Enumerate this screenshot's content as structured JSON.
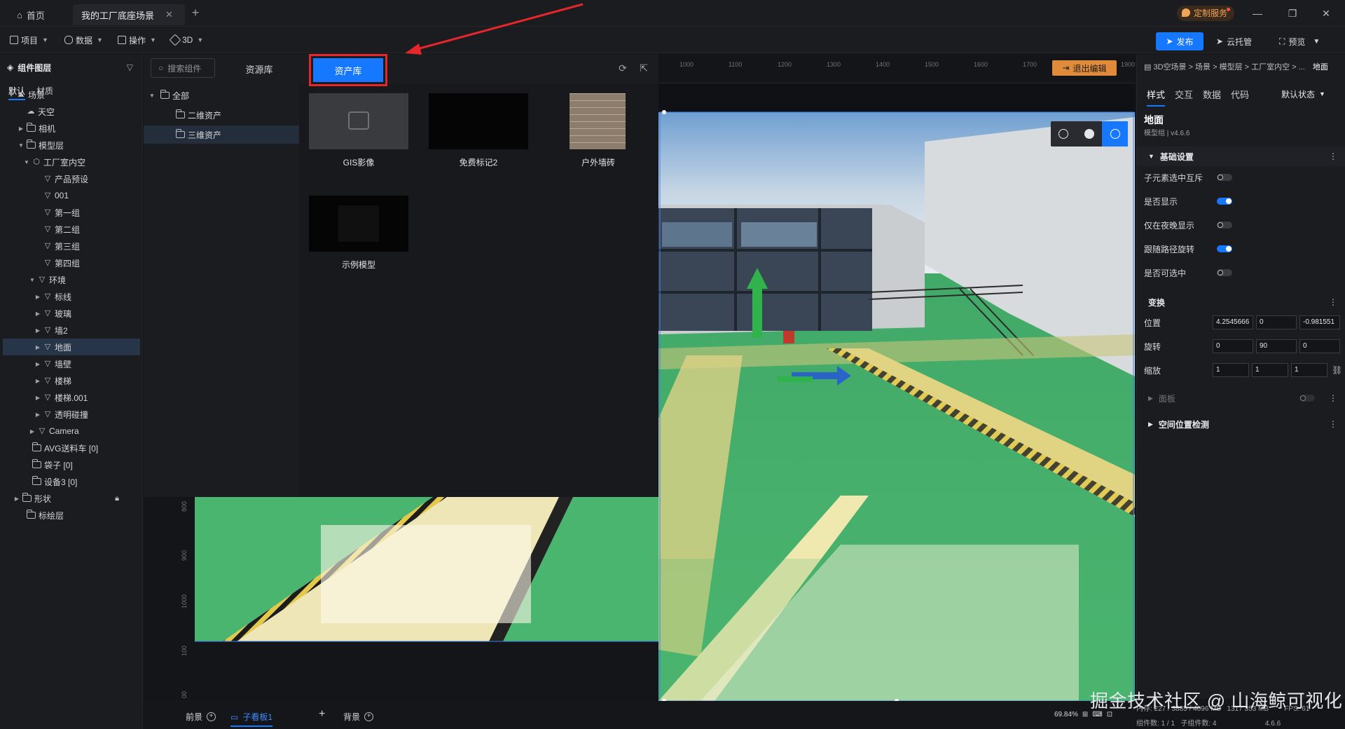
{
  "titlebar": {
    "tabs": [
      {
        "label": "首页"
      },
      {
        "label": "我的工厂底座场景"
      }
    ],
    "custom_service": "定制服务"
  },
  "toolbar": {
    "menus": [
      "项目",
      "数据",
      "操作",
      "3D"
    ],
    "publish": "发布",
    "cloud": "云托管",
    "preview": "预览"
  },
  "layer_panel": {
    "title": "组件图层",
    "tabs": [
      "默认",
      "材质"
    ],
    "items": [
      {
        "label": "场景"
      },
      {
        "label": "天空"
      },
      {
        "label": "相机"
      },
      {
        "label": "模型层"
      },
      {
        "label": "工厂室内空"
      },
      {
        "label": "产品预设"
      },
      {
        "label": "001"
      },
      {
        "label": "第一组"
      },
      {
        "label": "第二组"
      },
      {
        "label": "第三组"
      },
      {
        "label": "第四组"
      },
      {
        "label": "环境"
      },
      {
        "label": "标线"
      },
      {
        "label": "玻璃"
      },
      {
        "label": "墙2"
      },
      {
        "label": "地面"
      },
      {
        "label": "墙壁"
      },
      {
        "label": "楼梯"
      },
      {
        "label": "楼梯.001"
      },
      {
        "label": "透明碰撞"
      },
      {
        "label": "Camera"
      },
      {
        "label": "AVG送料车 [0]"
      },
      {
        "label": "袋子 [0]"
      },
      {
        "label": "设备3 [0]"
      },
      {
        "label": "形状"
      },
      {
        "label": "标绘层"
      }
    ]
  },
  "asset_panel": {
    "search_placeholder": "搜索组件",
    "resource_tab": "资源库",
    "asset_tab": "资产库",
    "tree": [
      {
        "label": "全部"
      },
      {
        "label": "二维资产"
      },
      {
        "label": "三维资产"
      }
    ],
    "assets": [
      {
        "label": "GIS影像"
      },
      {
        "label": "免费标记2"
      },
      {
        "label": "户外墙砖"
      },
      {
        "label": "示例模型"
      }
    ]
  },
  "viewport": {
    "ruler_top": [
      "1000",
      "1100",
      "1200",
      "1300",
      "1400",
      "1500",
      "1600",
      "1700",
      "1900"
    ],
    "ruler_left": [
      "800",
      "900",
      "1000",
      "100",
      "00"
    ],
    "exit_edit": "退出编辑"
  },
  "bottom_bar": {
    "foreground": "前景",
    "sub_board": "子看板1",
    "background": "背景",
    "zoom": "69.84%"
  },
  "status": {
    "line1": "内存: 227 / 3885 / 4096 MB   1317 353 MB        FPS: 61",
    "line2": "组件数: 1 / 1   子组件数: 4                         4.6.6"
  },
  "watermark": "掘金技术社区 @ 山海鲸可视化",
  "props": {
    "breadcrumb": "3D空场景 > 场景 > 模型层 > 工厂室内空 > ...",
    "breadcrumb_current": "地面",
    "tabs": [
      "样式",
      "交互",
      "数据",
      "代码"
    ],
    "state": "默认状态",
    "object_name": "地面",
    "object_sub": "模型组 | v4.6.6",
    "section_basic": "基础设置",
    "toggles": [
      {
        "label": "子元素选中互斥",
        "on": false
      },
      {
        "label": "是否显示",
        "on": true
      },
      {
        "label": "仅在夜晚显示",
        "on": false
      },
      {
        "label": "跟随路径旋转",
        "on": true
      },
      {
        "label": "是否可选中",
        "on": false
      }
    ],
    "section_transform": "变换",
    "position_label": "位置",
    "position": [
      "4.2545666",
      "0",
      "-0.981551"
    ],
    "rotation_label": "旋转",
    "rotation": [
      "0",
      "90",
      "0"
    ],
    "scale_label": "缩放",
    "scale": [
      "1",
      "1",
      "1"
    ],
    "section_panel": "面板",
    "section_space": "空间位置检测"
  }
}
